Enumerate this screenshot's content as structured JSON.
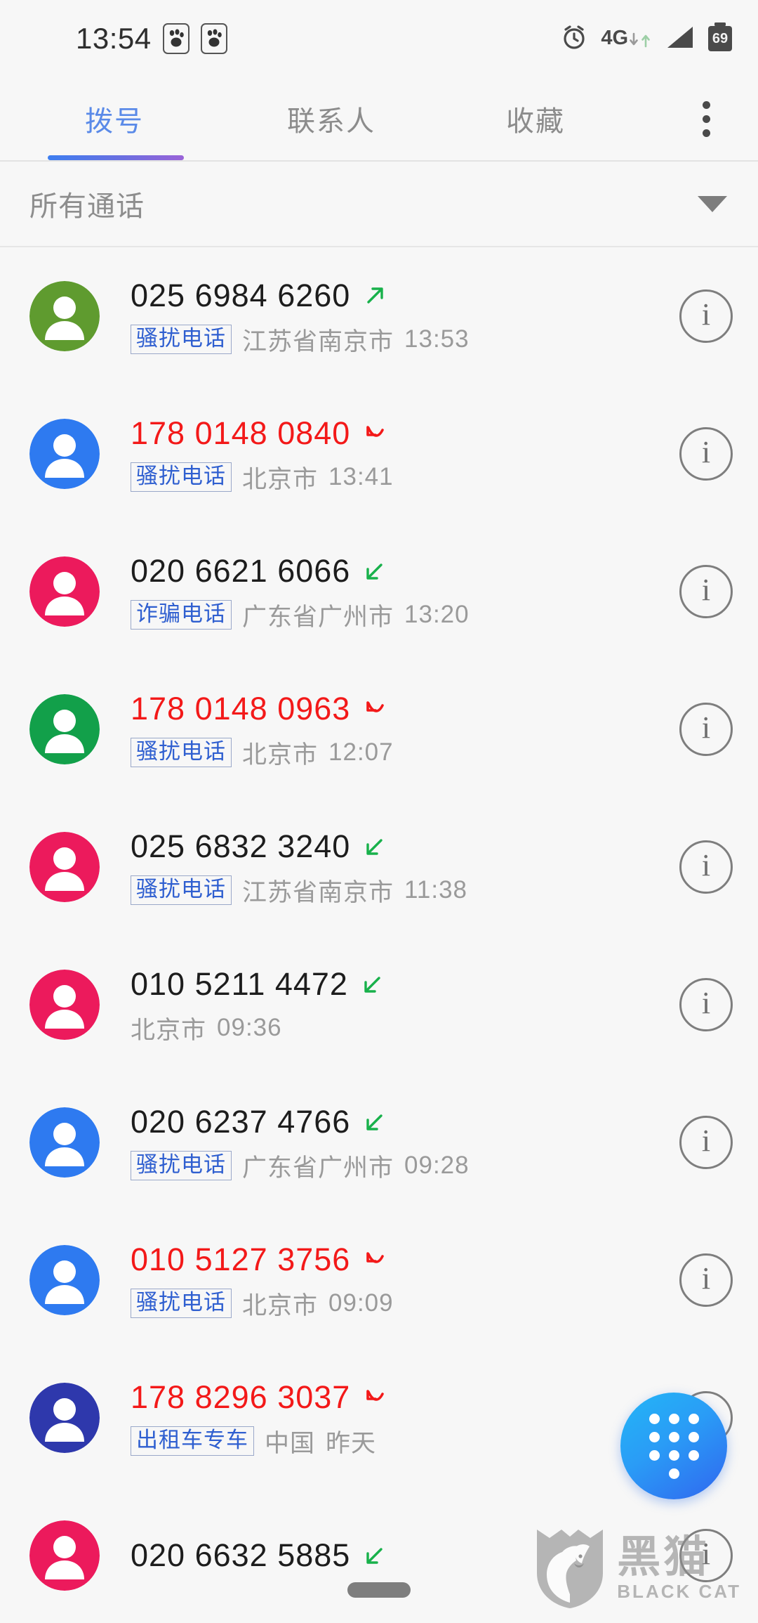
{
  "statusbar": {
    "clock": "13:54",
    "paw_icon_1": "paw-print-icon",
    "paw_icon_2": "paw-print-icon",
    "alarm_icon": "alarm-clock-icon",
    "network_label": "4G",
    "signal_icon": "signal-bars-icon",
    "battery_level": "69"
  },
  "tabs": {
    "items": [
      {
        "label": "拨号",
        "active": true
      },
      {
        "label": "联系人",
        "active": false
      },
      {
        "label": "收藏",
        "active": false
      }
    ],
    "overflow_icon": "more-vertical-icon",
    "active_underline_color": "#3d7ef0"
  },
  "filter": {
    "label": "所有通话",
    "caret_icon": "chevron-down-icon"
  },
  "calls": [
    {
      "number": "025 6984 6260",
      "missed": false,
      "direction": "outgoing",
      "tag": "骚扰电话",
      "location": "江苏省南京市",
      "time": "13:53",
      "avatar_color": "#5f9b2f",
      "info_icon": "info-circle-icon"
    },
    {
      "number": "178 0148 0840",
      "missed": true,
      "direction": "missed",
      "tag": "骚扰电话",
      "location": "北京市",
      "time": "13:41",
      "avatar_color": "#2e7af0",
      "info_icon": "info-circle-icon"
    },
    {
      "number": "020 6621 6066",
      "missed": false,
      "direction": "incoming",
      "tag": "诈骗电话",
      "location": "广东省广州市",
      "time": "13:20",
      "avatar_color": "#ec1a5c",
      "info_icon": "info-circle-icon"
    },
    {
      "number": "178 0148 0963",
      "missed": true,
      "direction": "missed",
      "tag": "骚扰电话",
      "location": "北京市",
      "time": "12:07",
      "avatar_color": "#12a04a",
      "info_icon": "info-circle-icon"
    },
    {
      "number": "025 6832 3240",
      "missed": false,
      "direction": "incoming",
      "tag": "骚扰电话",
      "location": "江苏省南京市",
      "time": "11:38",
      "avatar_color": "#ec1a5c",
      "info_icon": "info-circle-icon"
    },
    {
      "number": "010 5211 4472",
      "missed": false,
      "direction": "incoming",
      "tag": "",
      "location": "北京市",
      "time": "09:36",
      "avatar_color": "#ec1a5c",
      "info_icon": "info-circle-icon"
    },
    {
      "number": "020 6237 4766",
      "missed": false,
      "direction": "incoming",
      "tag": "骚扰电话",
      "location": "广东省广州市",
      "time": "09:28",
      "avatar_color": "#2e7af0",
      "info_icon": "info-circle-icon"
    },
    {
      "number": "010 5127 3756",
      "missed": true,
      "direction": "missed",
      "tag": "骚扰电话",
      "location": "北京市",
      "time": "09:09",
      "avatar_color": "#2e7af0",
      "info_icon": "info-circle-icon"
    },
    {
      "number": "178 8296 3037",
      "missed": true,
      "direction": "missed",
      "tag": "出租车专车",
      "location": "中国",
      "time": "昨天",
      "avatar_color": "#2e38ac",
      "info_icon": "info-circle-icon"
    },
    {
      "number": "020 6632 5885",
      "missed": false,
      "direction": "incoming",
      "tag": "",
      "location": "",
      "time": "",
      "avatar_color": "#ec1a5c",
      "info_icon": "info-circle-icon"
    }
  ],
  "fab": {
    "icon": "dialpad-icon",
    "gradient_from": "#23b6f7",
    "gradient_to": "#3066ef"
  },
  "watermark": {
    "cn": "黑猫",
    "en": "BLACK CAT",
    "logo_icon": "black-cat-shield-icon"
  },
  "navbar": {
    "pill_icon": "home-indicator-pill"
  }
}
